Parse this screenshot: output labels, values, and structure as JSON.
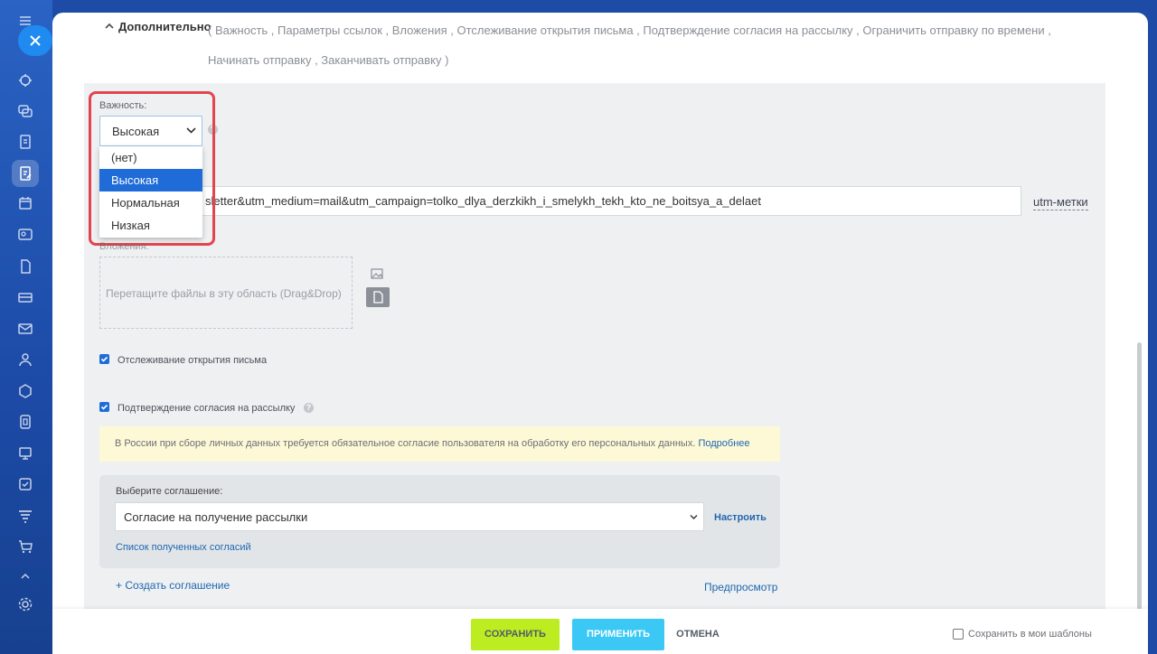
{
  "sidebar": {
    "close_label": "Закрыть",
    "icons": [
      "menu-icon",
      "feed-icon",
      "chat-icon",
      "tasks-icon",
      "crm-icon",
      "calendar-icon",
      "contact-center-icon",
      "documents-icon",
      "sites-icon",
      "mail-icon",
      "employees-icon",
      "automation-icon",
      "drive-icon",
      "meetings-icon",
      "tasks-check-icon",
      "sales-funnel-icon",
      "shop-icon",
      "more-icon",
      "settings-icon"
    ]
  },
  "advanced": {
    "title": "Дополнительно",
    "summary": "( Важность ,  Параметры ссылок ,  Вложения ,  Отслеживание открытия письма ,  Подтверждение согласия на рассылку ,  Ограничить отправку по времени ,  Начинать отправку ,  Заканчивать отправку  )"
  },
  "importance": {
    "label": "Важность:",
    "selected": "Высокая",
    "options": [
      "(нет)",
      "Высокая",
      "Нормальная",
      "Низкая"
    ],
    "selected_index": 1
  },
  "links": {
    "url_value": "sletter&utm_medium=mail&utm_campaign=tolko_dlya_derzkikh_i_smelykh_tekh_kto_ne_boitsya_a_delaet",
    "utm_button": "utm-метки"
  },
  "attachments": {
    "label": "Вложения:",
    "dropzone_text": "Перетащите файлы в эту область (Drag&Drop)"
  },
  "tracking": {
    "label": "Отслеживание открытия письма",
    "checked": true
  },
  "consent": {
    "label": "Подтверждение согласия на рассылку",
    "checked": true,
    "notice": "В России при сборе личных данных требуется обязательное согласие пользователя на обработку его персональных данных.",
    "notice_link": "Подробнее",
    "agreement_label": "Выберите соглашение:",
    "agreement_value": "Согласие на получение рассылки",
    "configure_link": "Настроить",
    "list_link": "Список полученных согласий",
    "create_link": "+ Создать соглашение",
    "preview_link": "Предпросмотр"
  },
  "footer": {
    "save": "СОХРАНИТЬ",
    "apply": "ПРИМЕНИТЬ",
    "cancel": "ОТМЕНА",
    "save_template": "Сохранить в мои шаблоны"
  },
  "colors": {
    "accent": "#1f6cd9",
    "save_button": "#bbed21",
    "apply_button": "#3bc8f5",
    "highlight": "#e2454f"
  }
}
